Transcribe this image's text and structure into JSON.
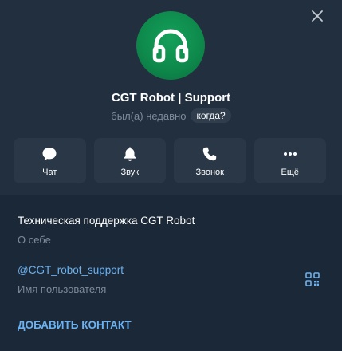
{
  "profile": {
    "name": "CGT Robot | Support",
    "status": "был(а) недавно",
    "when_badge": "когда?"
  },
  "actions": [
    {
      "label": "Чат",
      "icon": "chat-bubble-icon"
    },
    {
      "label": "Звук",
      "icon": "bell-icon"
    },
    {
      "label": "Звонок",
      "icon": "phone-icon"
    },
    {
      "label": "Ещё",
      "icon": "more-dots-icon"
    }
  ],
  "info": {
    "bio": "Техническая поддержка CGT Robot",
    "bio_caption": "О себе",
    "username": "@CGT_robot_support",
    "username_caption": "Имя пользователя",
    "add_contact": "ДОБАВИТЬ КОНТАКТ"
  },
  "colors": {
    "accent": "#6ab2f2",
    "avatar_green": "#0e8a4c",
    "background": "#1b2837"
  }
}
